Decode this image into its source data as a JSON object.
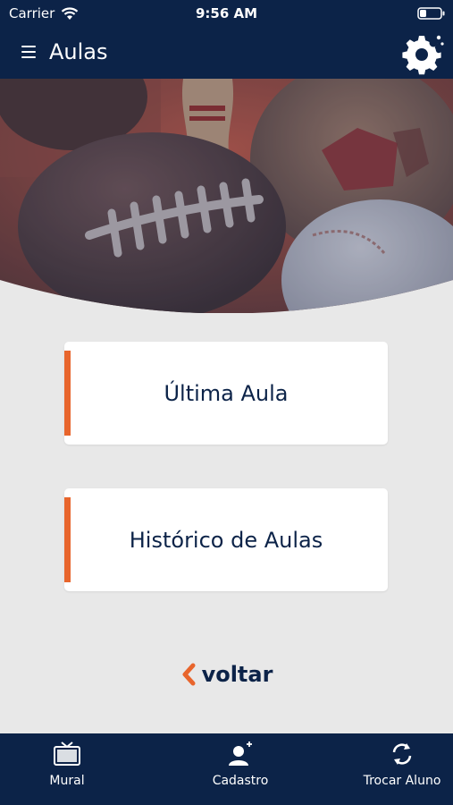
{
  "status_bar": {
    "carrier": "Carrier",
    "time": "9:56 AM"
  },
  "header": {
    "title": "Aulas",
    "menu_icon": "hamburger-menu-icon",
    "settings_icon": "gear-icon"
  },
  "hero": {
    "image": "sports-balls-banner"
  },
  "menu": {
    "items": [
      {
        "label": "Última Aula"
      },
      {
        "label": "Histórico de Aulas"
      }
    ]
  },
  "back": {
    "label": "voltar",
    "icon": "chevron-left-icon"
  },
  "tab_bar": {
    "items": [
      {
        "label": "Mural",
        "icon": "tv-icon"
      },
      {
        "label": "Cadastro",
        "icon": "user-add-icon"
      },
      {
        "label": "Trocar Aluno",
        "icon": "refresh-icon"
      }
    ]
  },
  "colors": {
    "primary": "#0c2348",
    "accent": "#e8652c",
    "background": "#e8e8e8",
    "card": "#ffffff"
  }
}
